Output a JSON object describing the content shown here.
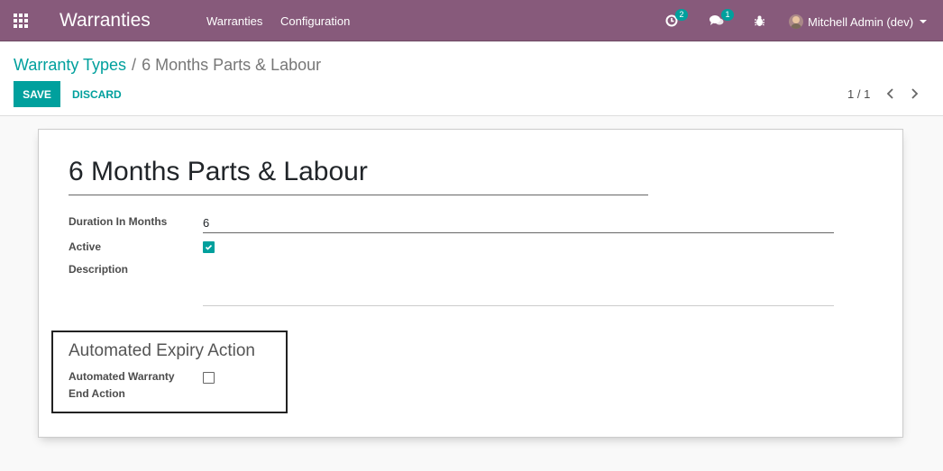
{
  "app": {
    "title": "Warranties",
    "menu": [
      "Warranties",
      "Configuration"
    ]
  },
  "systray": {
    "activity_icon": "clock-icon",
    "activity_count": "2",
    "messages_icon": "chat-bubbles-icon",
    "messages_count": "1",
    "debug_icon": "bug-icon",
    "user_name": "Mitchell Admin (dev)"
  },
  "breadcrumb": {
    "parent": "Warranty Types",
    "separator": "/",
    "current": "6 Months Parts & Labour"
  },
  "buttons": {
    "save": "SAVE",
    "discard": "DISCARD"
  },
  "pager": {
    "value": "1 / 1"
  },
  "form": {
    "name": "6 Months Parts & Labour",
    "fields": {
      "duration_label": "Duration In Months",
      "duration_value": "6",
      "active_label": "Active",
      "active_checked": true,
      "description_label": "Description",
      "description_value": ""
    },
    "group": {
      "title": "Automated Expiry Action",
      "automated_end_label_line1": "Automated Warranty",
      "automated_end_label_line2": "End Action",
      "automated_end_checked": false
    }
  },
  "colors": {
    "navbar": "#875a7b",
    "accent": "#00a09d",
    "background": "#f9f9f9"
  }
}
